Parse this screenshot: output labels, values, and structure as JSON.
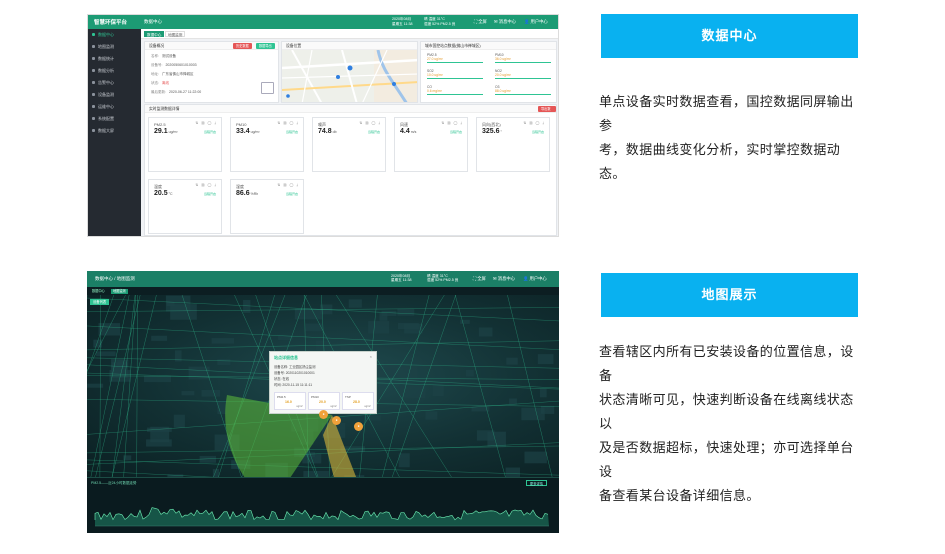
{
  "screenshot1": {
    "brand": "智慧环保平台",
    "breadcrumb": "数据中心",
    "top_meta_left": [
      "2020年08月",
      "星期五 11:38"
    ],
    "top_meta_right": [
      "晴 温度 31°C",
      "湿度 52% PM2.5 良"
    ],
    "top_tools": [
      "全屏",
      "消息中心",
      "用户中心"
    ],
    "sidebar": [
      "数据中心",
      "地图监测",
      "数据统计",
      "数据分析",
      "告警中心",
      "设备监测",
      "运维中心",
      "系统配置",
      "数据大屏"
    ],
    "tabs": [
      "数据中心",
      "地图监测"
    ],
    "basic_panel": {
      "title": "设备概况",
      "btn_alarm": "历史数据",
      "btn_export": "数据导出",
      "rows": [
        {
          "k": "名称:",
          "v": "测试设备"
        },
        {
          "k": "设备号:",
          "v": "2020050601010003"
        },
        {
          "k": "地址:",
          "v": "广东省佛山市禅城区"
        },
        {
          "k": "状态:",
          "v": "离线"
        },
        {
          "k": "最后更新:",
          "v": "2020-06-27 11:22:00"
        }
      ]
    },
    "map_panel": {
      "title": "设备位置"
    },
    "aqi_panel": {
      "title": "城市国控站点数据(佛山市禅城区)",
      "items": [
        {
          "name": "PM2.5",
          "value": "27.0 ug/m³"
        },
        {
          "name": "PM10",
          "value": "36.0 ug/m³"
        },
        {
          "name": "SO2",
          "value": "10.0 ug/m³"
        },
        {
          "name": "NO2",
          "value": "20.0 ug/m³"
        },
        {
          "name": "CO",
          "value": "0.6 mg/m³"
        },
        {
          "name": "O3",
          "value": "88.0 ug/m³"
        }
      ]
    },
    "realtime_panel": {
      "title": "实时监测数据详情",
      "btn": "导出数据"
    },
    "cards": [
      {
        "name": "PM2.5",
        "value": "29.1",
        "unit": "ug/m³",
        "status": "远程开启"
      },
      {
        "name": "PM10",
        "value": "33.4",
        "unit": "ug/m³",
        "status": "远程开启"
      },
      {
        "name": "噪声",
        "value": "74.8",
        "unit": "db",
        "status": "远程开启"
      },
      {
        "name": "风速",
        "value": "4.4",
        "unit": "m/s",
        "status": "远程开启"
      },
      {
        "name": "风向(西北)",
        "value": "325.6",
        "unit": "°",
        "status": "远程开启"
      },
      {
        "name": "温度",
        "value": "20.5",
        "unit": "°C",
        "status": "远程开启"
      },
      {
        "name": "湿度",
        "value": "86.6",
        "unit": "%Rh",
        "status": "远程开启"
      }
    ]
  },
  "screenshot2": {
    "breadcrumb": "数据中心 / 地图监测",
    "top_meta_left": [
      "2020年08月",
      "星期五 11:38"
    ],
    "top_meta_right": [
      "晴 温度 31°C",
      "湿度 52% PM2.5 良"
    ],
    "top_tools": [
      "全屏",
      "消息中心",
      "用户中心"
    ],
    "tabs": [
      "数据中心",
      "地图监测"
    ],
    "map_button": "设备列表",
    "popup": {
      "title": "站点详细信息",
      "rows": [
        "设备名称: 工业园区扬尘监测",
        "设备号: 2020110201010001",
        "状态: 在线",
        "时间: 2020-11-15 11:11:11"
      ],
      "metrics": [
        {
          "name": "PM2.5",
          "value": "16.0",
          "unit": "ug/m³"
        },
        {
          "name": "PM10",
          "value": "20.0",
          "unit": "ug/m³"
        },
        {
          "name": "TSP",
          "value": "28.0",
          "unit": "ug/m³"
        }
      ]
    },
    "chart_title": "PM2.5——近24小时数据走势",
    "chart_button": "更多详情"
  },
  "section1": {
    "heading": "数据中心",
    "lines": [
      "单点设备实时数据查看，国控数据同屏输出参",
      "考，数据曲线变化分析，实时掌控数据动态。"
    ]
  },
  "section2": {
    "heading": "地图展示",
    "lines": [
      "查看辖区内所有已安装设备的位置信息，设备",
      "状态清晰可见，快速判断设备在线离线状态以",
      "及是否数据超标，快速处理；亦可选择单台设",
      "备查看某台设备详细信息。"
    ]
  },
  "colors": {
    "accent": "#09b1f0",
    "ui_green": "#1c9b74",
    "ok_green": "#2ec493",
    "alarm_red": "#e55656"
  }
}
